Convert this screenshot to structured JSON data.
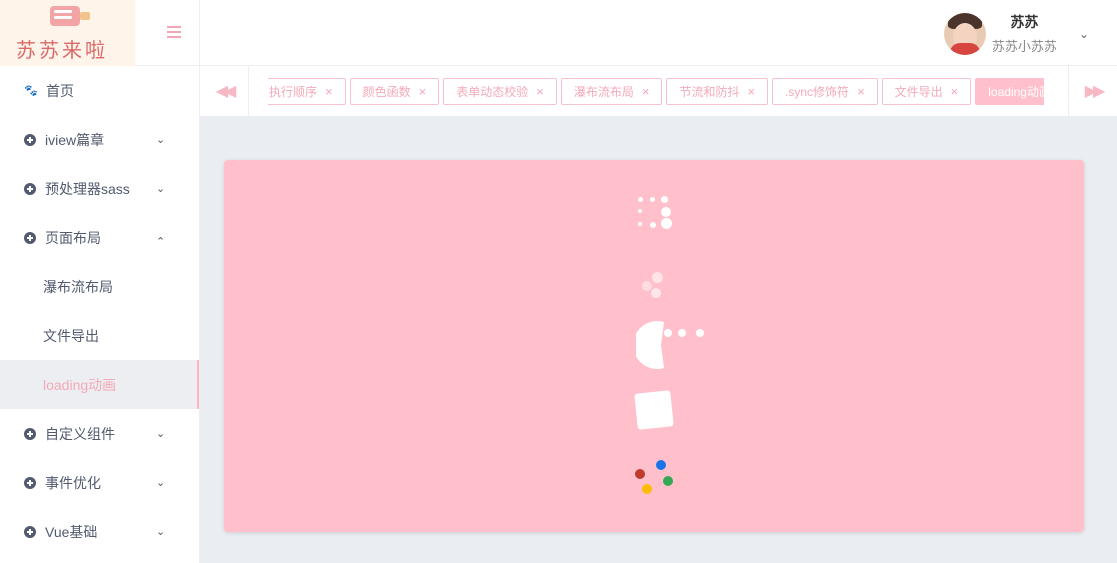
{
  "logo": {
    "text": "苏苏来啦"
  },
  "sidebar": {
    "items": [
      {
        "label": "首页",
        "icon": "paw-icon"
      },
      {
        "label": "iview篇章",
        "icon": "circle-plus-icon",
        "expand_icon": "chevron-down-icon"
      },
      {
        "label": "预处理器sass",
        "icon": "circle-plus-icon",
        "expand_icon": "chevron-down-icon"
      },
      {
        "label": "页面布局",
        "icon": "circle-plus-icon",
        "expand_icon": "chevron-up-icon"
      },
      {
        "label": "自定义组件",
        "icon": "circle-plus-icon",
        "expand_icon": "chevron-down-icon"
      },
      {
        "label": "事件优化",
        "icon": "circle-plus-icon",
        "expand_icon": "chevron-down-icon"
      },
      {
        "label": "Vue基础",
        "icon": "circle-plus-icon",
        "expand_icon": "chevron-down-icon"
      }
    ],
    "sub_items": [
      {
        "label": "瀑布流布局"
      },
      {
        "label": "文件导出"
      },
      {
        "label": "loading动画",
        "active": true
      }
    ]
  },
  "header": {
    "user_name": "苏苏",
    "user_subtitle": "苏苏小苏苏"
  },
  "tabs": [
    {
      "label": "执行顺序"
    },
    {
      "label": "颜色函数"
    },
    {
      "label": "表单动态校验"
    },
    {
      "label": "瀑布流布局"
    },
    {
      "label": "节流和防抖"
    },
    {
      "label": ".sync修饰符"
    },
    {
      "label": "文件导出"
    },
    {
      "label": "loading动画",
      "active": true
    }
  ],
  "colors": {
    "accent_pink": "#ffc0cb",
    "content_bg": "#eaedf1",
    "loader_colors": [
      "#c0392b",
      "#1a73e8",
      "#34a853",
      "#fbbc05"
    ]
  }
}
